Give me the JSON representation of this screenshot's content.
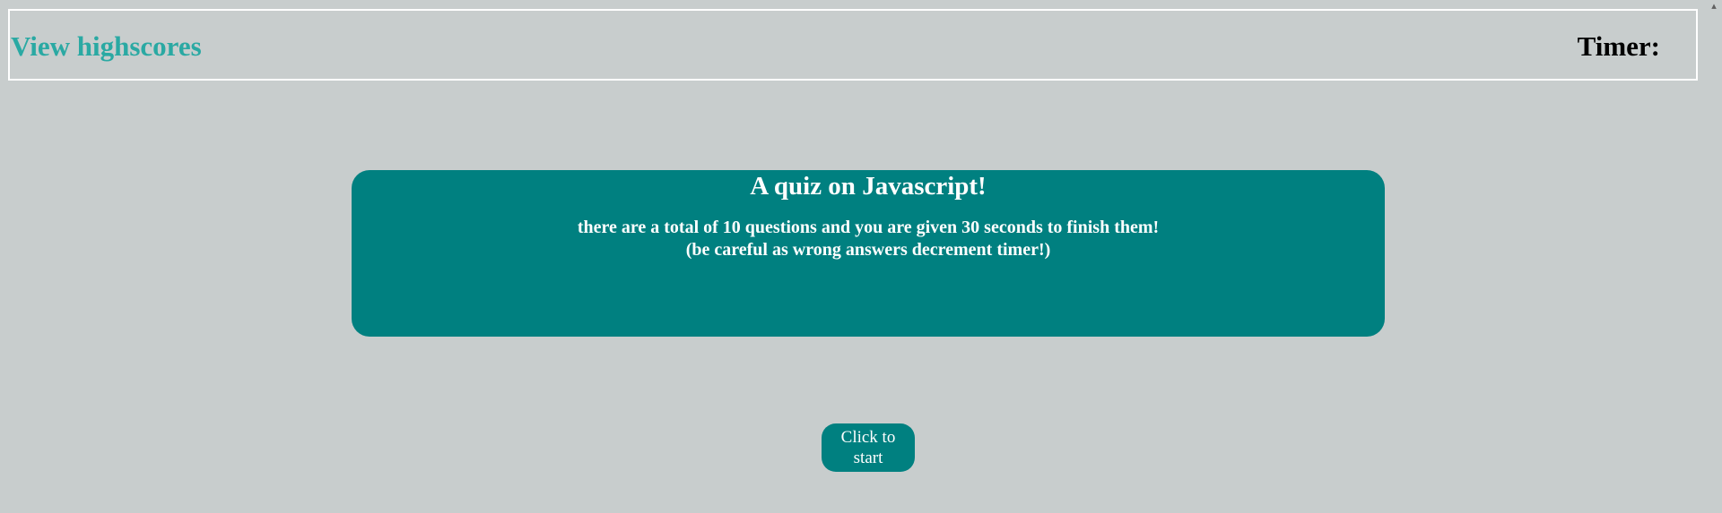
{
  "header": {
    "highscores_link": "View highscores",
    "timer_label": "Timer:",
    "timer_value": ""
  },
  "intro": {
    "title": "A quiz on Javascript!",
    "line1": "there are a total of 10 questions and you are given 30 seconds to finish them!",
    "line2": "(be careful as wrong answers decrement timer!)"
  },
  "start_button": {
    "label": "Click to start"
  },
  "scrollbar": {
    "up_icon": "chevron-up-icon"
  },
  "colors": {
    "background": "#c8cdcd",
    "accent": "#008080",
    "link": "#2aa9a3"
  }
}
